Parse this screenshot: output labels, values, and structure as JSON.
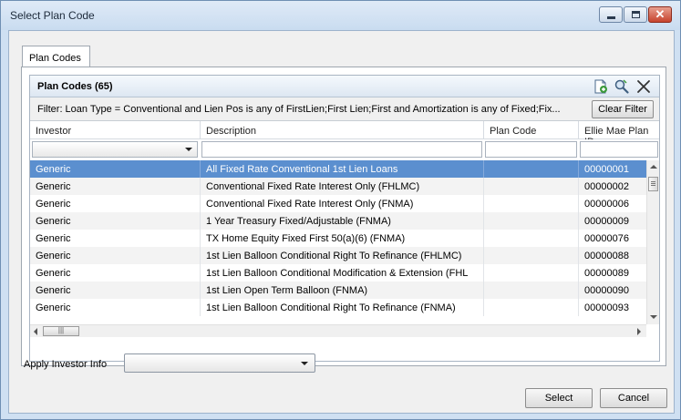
{
  "window": {
    "title": "Select Plan Code"
  },
  "tabs": [
    {
      "label": "Plan Codes"
    }
  ],
  "grid": {
    "title": "Plan Codes (65)",
    "filter_text": "Filter: Loan Type = Conventional  and  Lien Pos is any of FirstLien;First Lien;First  and  Amortization is any of Fixed;Fix...",
    "clear_filter_label": "Clear Filter",
    "icons": [
      "export-icon",
      "search-icon",
      "close-icon"
    ],
    "columns": [
      "Investor",
      "Description",
      "Plan Code",
      "Ellie Mae Plan ID"
    ],
    "rows": [
      {
        "investor": "Generic",
        "description": "All Fixed Rate Conventional 1st Lien Loans",
        "plan_code": "",
        "plan_id": "00000001"
      },
      {
        "investor": "Generic",
        "description": "Conventional Fixed Rate Interest Only (FHLMC)",
        "plan_code": "",
        "plan_id": "00000002"
      },
      {
        "investor": "Generic",
        "description": "Conventional Fixed Rate Interest Only (FNMA)",
        "plan_code": "",
        "plan_id": "00000006"
      },
      {
        "investor": "Generic",
        "description": "1 Year Treasury Fixed/Adjustable  (FNMA)",
        "plan_code": "",
        "plan_id": "00000009"
      },
      {
        "investor": "Generic",
        "description": "TX Home Equity Fixed First 50(a)(6) (FNMA)",
        "plan_code": "",
        "plan_id": "00000076"
      },
      {
        "investor": "Generic",
        "description": "1st Lien Balloon Conditional Right To Refinance (FHLMC)",
        "plan_code": "",
        "plan_id": "00000088"
      },
      {
        "investor": "Generic",
        "description": "1st Lien Balloon Conditional Modification & Extension (FHL",
        "plan_code": "",
        "plan_id": "00000089"
      },
      {
        "investor": "Generic",
        "description": "1st Lien Open Term Balloon (FNMA)",
        "plan_code": "",
        "plan_id": "00000090"
      },
      {
        "investor": "Generic",
        "description": "1st Lien Balloon Conditional Right To Refinance (FNMA)",
        "plan_code": "",
        "plan_id": "00000093"
      }
    ],
    "selected_row": 0
  },
  "apply_investor_label": "Apply Investor Info",
  "buttons": {
    "select": "Select",
    "cancel": "Cancel"
  },
  "colors": {
    "selection": "#5b8fcf",
    "titlebar": "#c9dcf0",
    "close_button": "#c7432d"
  }
}
